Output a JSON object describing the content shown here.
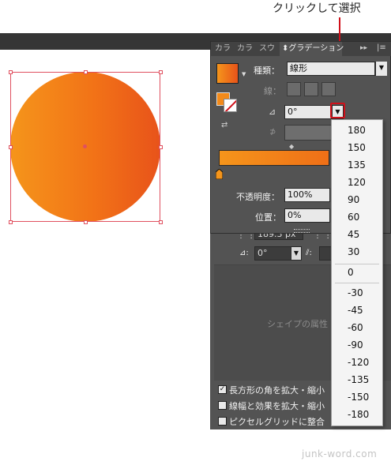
{
  "annotation": {
    "text": "クリックして選択"
  },
  "canvas": {
    "gradient_start": "#f5951b",
    "gradient_end": "#e8531a",
    "selection_color": "#e0505f"
  },
  "gradient_panel": {
    "tabs": [
      "カラ",
      "カラ",
      "スウ",
      "グラデーション"
    ],
    "type_label": "種類：",
    "type_value": "線形",
    "stroke_label": "線：",
    "angle_value": "0°",
    "opacity_label": "不透明度：",
    "opacity_value": "100%",
    "position_label": "位置：",
    "position_value": "0%"
  },
  "angle_dropdown": {
    "options_positive": [
      "180",
      "150",
      "135",
      "120",
      "90",
      "60",
      "45",
      "30"
    ],
    "option_zero": "0",
    "options_negative": [
      "-30",
      "-45",
      "-60",
      "-90",
      "-120",
      "-135",
      "-150",
      "-180"
    ]
  },
  "transform_panel": {
    "width_value": "189.3 px",
    "angle_value": "0°",
    "shape_props_text": "シェイプの属性",
    "checkboxes": [
      {
        "label": "長方形の角を拡大・縮小",
        "checked": true
      },
      {
        "label": "線幅と効果を拡大・縮小",
        "checked": false
      },
      {
        "label": "ピクセルグリッドに整合",
        "checked": false
      }
    ]
  },
  "watermark": "junk-word.com"
}
